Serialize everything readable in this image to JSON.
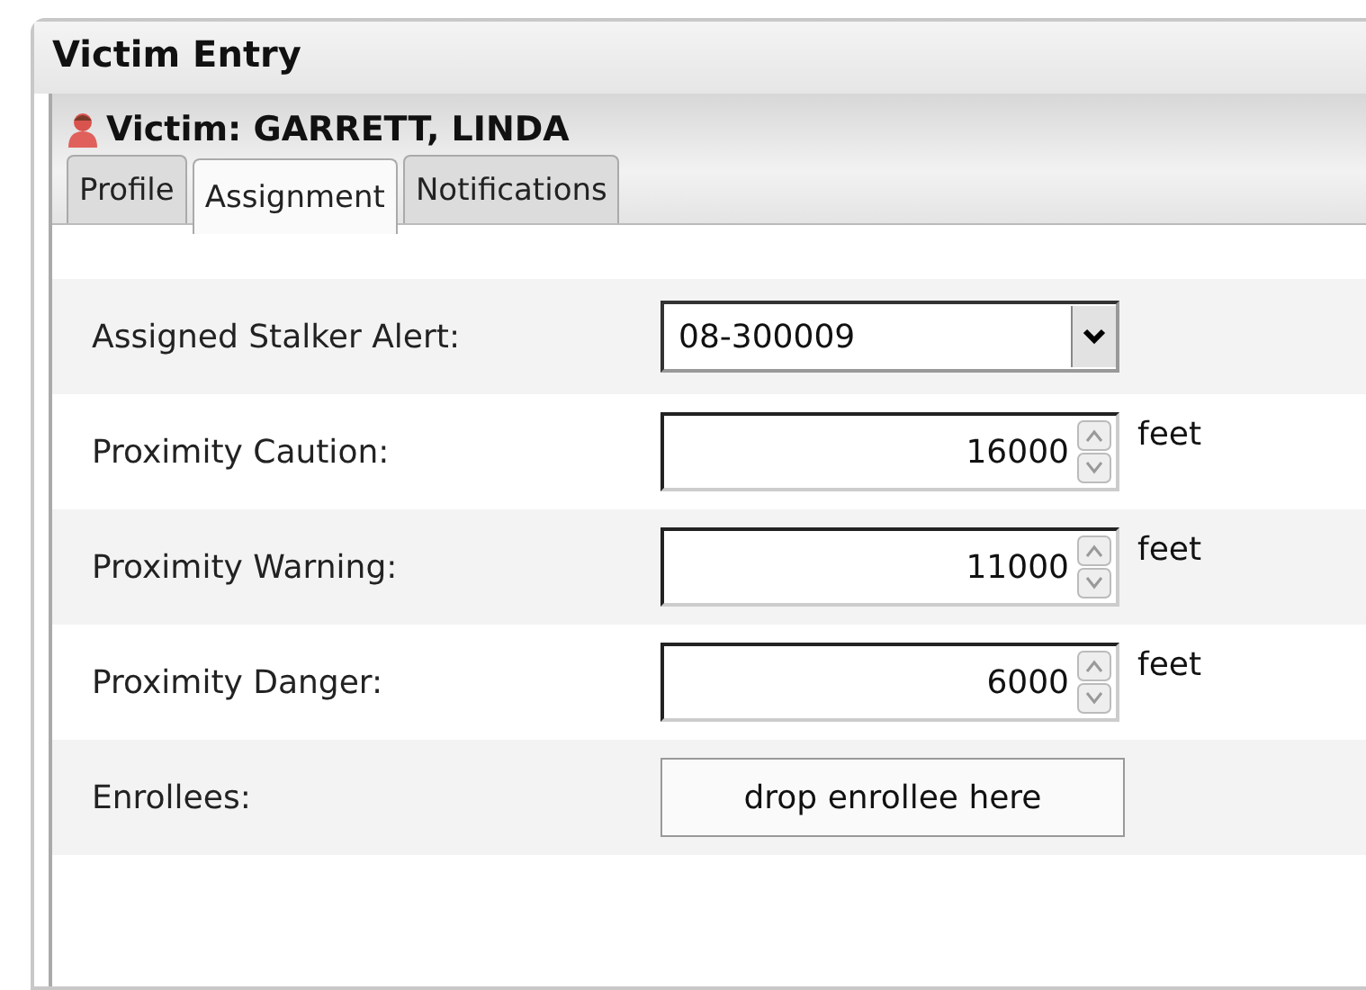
{
  "window": {
    "title": "Victim Entry"
  },
  "header": {
    "title": "Victim: GARRETT, LINDA"
  },
  "tabs": [
    {
      "label": "Profile",
      "selected": false
    },
    {
      "label": "Assignment",
      "selected": true
    },
    {
      "label": "Notifications",
      "selected": false
    }
  ],
  "form": [
    {
      "kind": "select",
      "label": "Assigned Stalker Alert:",
      "value": "08-300009"
    },
    {
      "kind": "spinner",
      "label": "Proximity Caution:",
      "value": "16000",
      "unit": "feet"
    },
    {
      "kind": "spinner",
      "label": "Proximity Warning:",
      "value": "11000",
      "unit": "feet"
    },
    {
      "kind": "spinner",
      "label": "Proximity Danger:",
      "value": "6000",
      "unit": "feet"
    },
    {
      "kind": "dropzone",
      "label": "Enrollees:",
      "value": "drop enrollee here"
    }
  ]
}
